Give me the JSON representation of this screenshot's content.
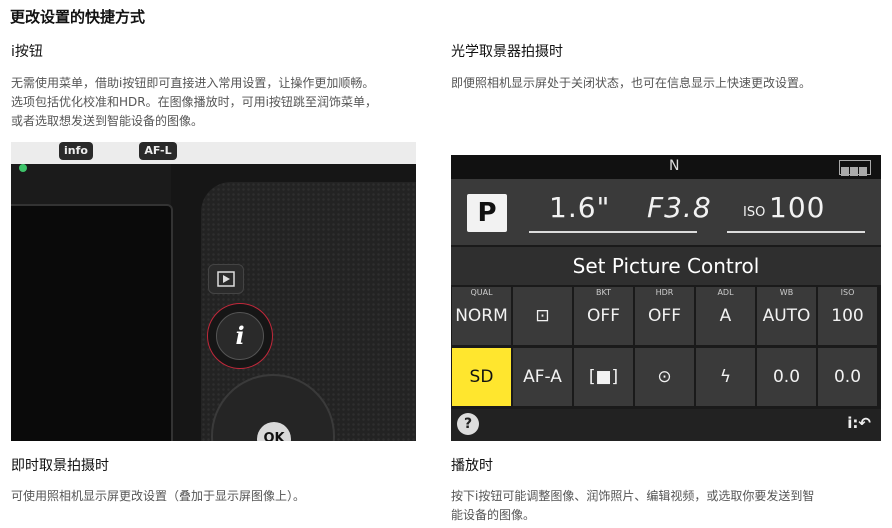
{
  "page_title": "更改设置的快捷方式",
  "sections": {
    "i_button": {
      "heading": "i按钮",
      "text_line1": "无需使用菜单，借助i按钮即可直接进入常用设置，让操作更加顺畅。",
      "text_line2": "选项包括优化校准和HDR。在图像播放时，可用i按钮跳至润饰菜单，",
      "text_line3": "或者选取想发送到智能设备的图像。"
    },
    "viewfinder": {
      "heading": "光学取景器拍摄时",
      "text": "即便照相机显示屏处于关闭状态，也可在信息显示上快速更改设置。"
    },
    "liveview": {
      "heading": "即时取景拍摄时",
      "text": "可使用照相机显示屏更改设置（叠加于显示屏图像上）。"
    },
    "playback": {
      "heading": "播放时",
      "text_line1": "按下i按钮可能调整图像、润饰照片、编辑视频，或选取你要发送到智",
      "text_line2": "能设备的图像。"
    }
  },
  "camera": {
    "info_label": "info",
    "afl_label": "AF-L",
    "i_label": "i",
    "ok_label": "OK"
  },
  "info_panel": {
    "top_label": "N",
    "mode": "P",
    "shutter": "1.6\"",
    "aperture": "F3.8",
    "iso_label": "ISO",
    "iso_value": "100",
    "menu_title": "Set Picture Control",
    "row1": [
      {
        "label": "QUAL",
        "value": "NORM"
      },
      {
        "label": "",
        "value": "⊡"
      },
      {
        "label": "BKT",
        "value": "OFF"
      },
      {
        "label": "HDR",
        "value": "OFF"
      },
      {
        "label": "ADL",
        "value": "A"
      },
      {
        "label": "WB",
        "value": "AUTO"
      },
      {
        "label": "ISO",
        "value": "100"
      }
    ],
    "row2": [
      {
        "label": "",
        "value": "SD",
        "selected": true
      },
      {
        "label": "",
        "value": "AF-A"
      },
      {
        "label": "",
        "value": "[■]"
      },
      {
        "label": "",
        "value": "⊙"
      },
      {
        "label": "",
        "value": "ϟ"
      },
      {
        "label": "",
        "value": "0.0"
      },
      {
        "label": "",
        "value": "0.0"
      }
    ],
    "help": "?",
    "back": "i:↶"
  }
}
